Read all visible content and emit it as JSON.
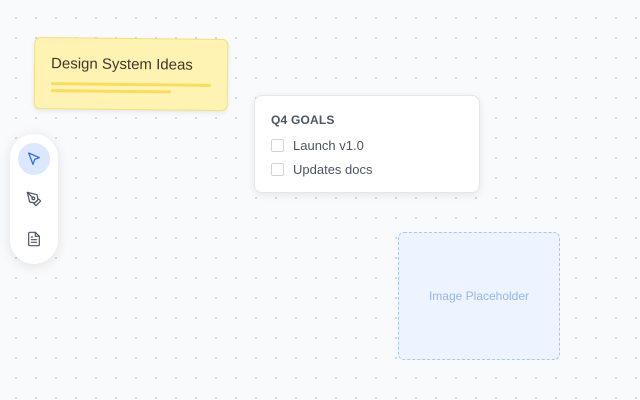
{
  "sticky_note": {
    "title": "Design System Ideas",
    "color": "#fef3b3"
  },
  "toolbar": {
    "tools": [
      {
        "icon": "cursor-arrow-icon",
        "active": true
      },
      {
        "icon": "pen-tool-icon",
        "active": false
      },
      {
        "icon": "document-icon",
        "active": false
      }
    ],
    "accent": "#3b6fe0"
  },
  "goals_card": {
    "title": "Q4 GOALS",
    "items": [
      {
        "label": "Launch v1.0",
        "checked": false
      },
      {
        "label": "Updates docs",
        "checked": false
      }
    ]
  },
  "image_placeholder": {
    "label": "Image Placeholder"
  }
}
